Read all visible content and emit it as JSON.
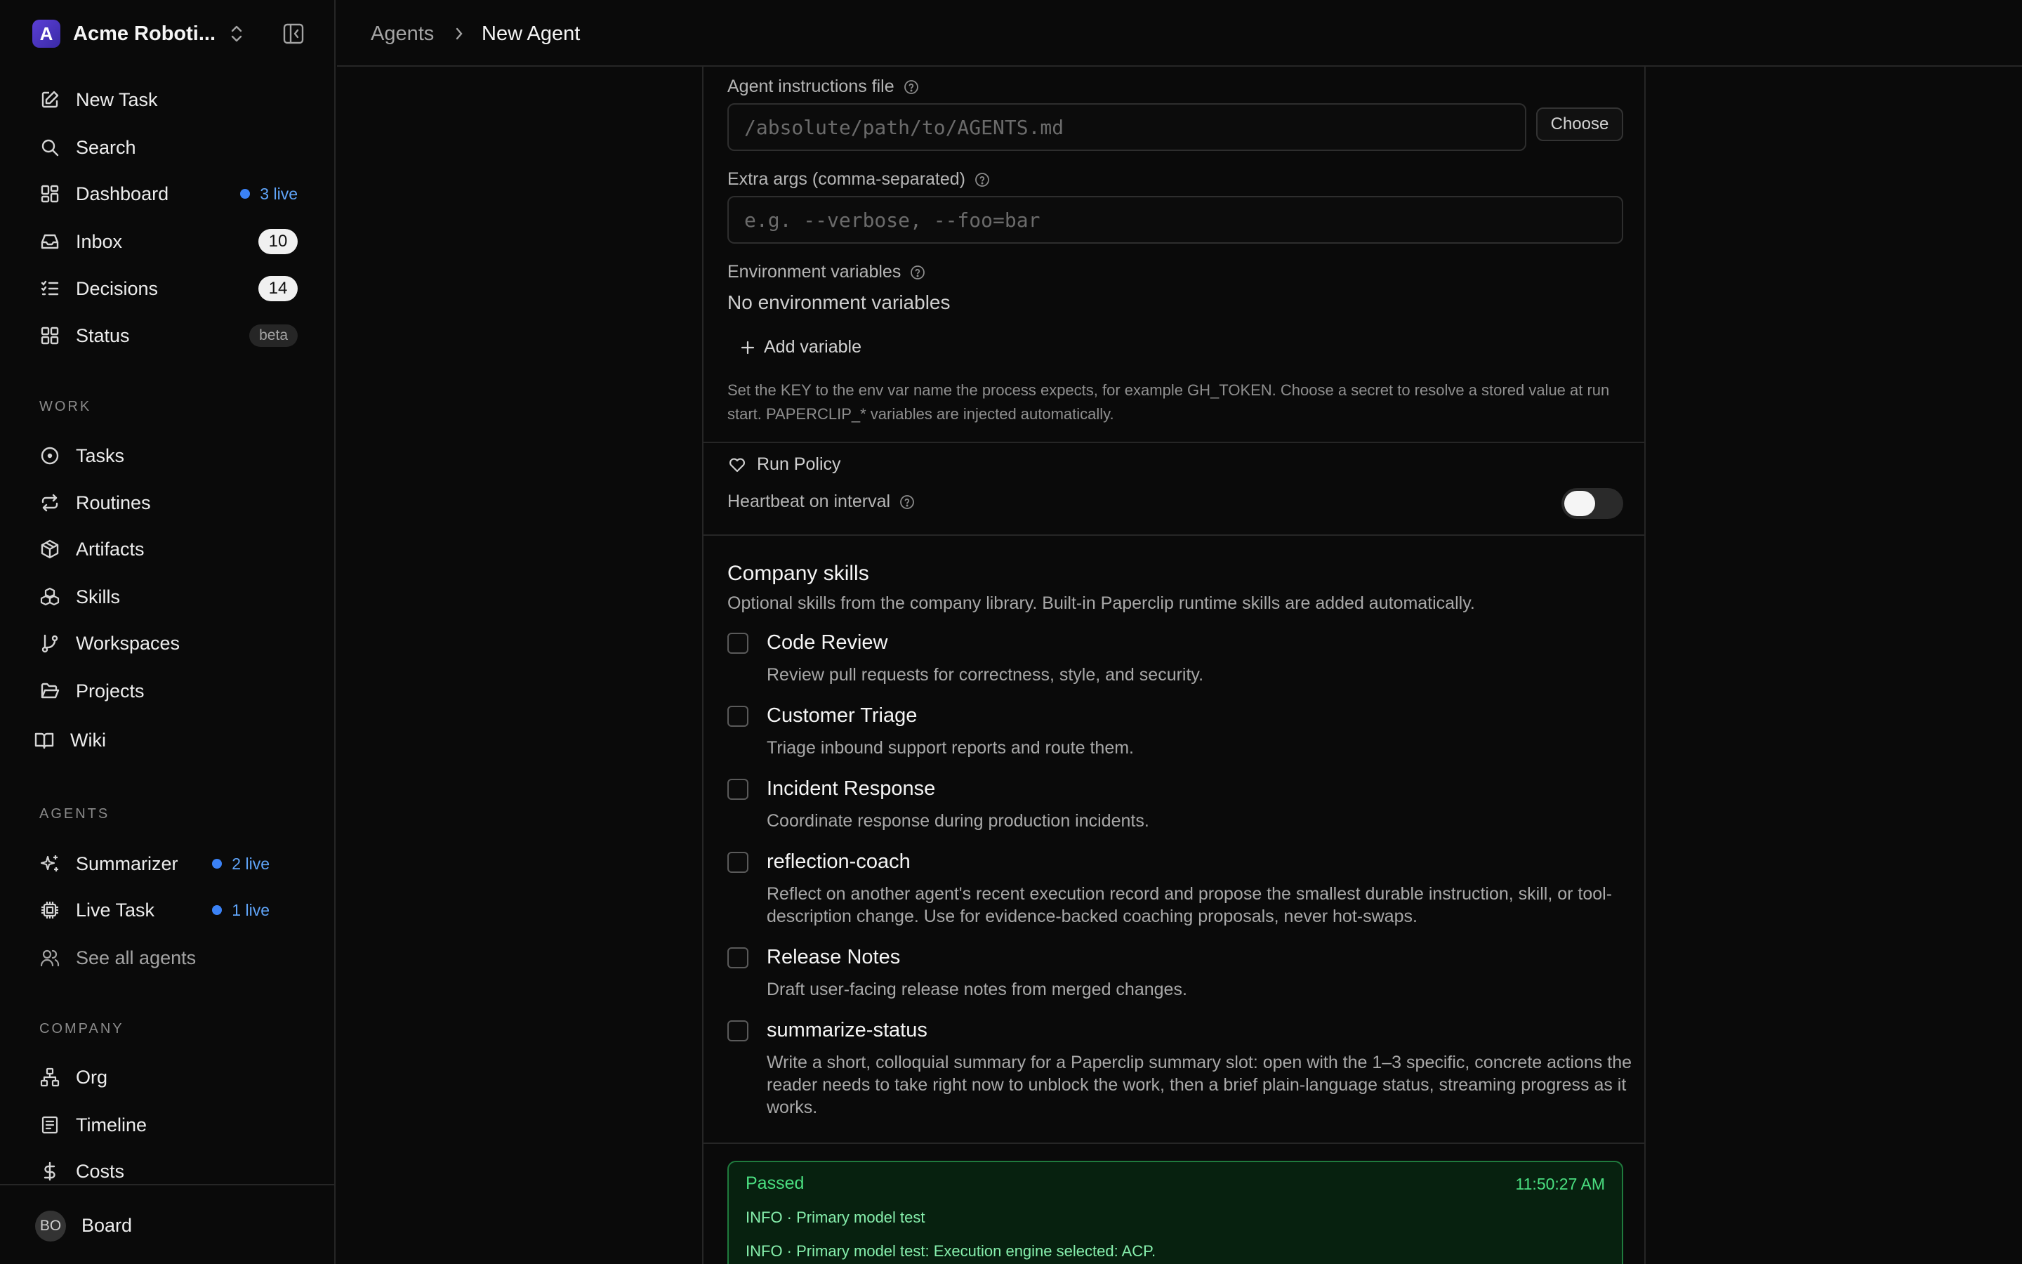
{
  "sidebar": {
    "company_initial": "A",
    "company_name": "Acme Roboti...",
    "nav": [
      {
        "label": "New Task"
      },
      {
        "label": "Search"
      },
      {
        "label": "Dashboard",
        "live": "3 live"
      },
      {
        "label": "Inbox",
        "count": "10"
      },
      {
        "label": "Decisions",
        "count": "14"
      },
      {
        "label": "Status",
        "tag": "beta"
      }
    ],
    "work_label": "WORK",
    "work": [
      {
        "label": "Tasks"
      },
      {
        "label": "Routines"
      },
      {
        "label": "Artifacts"
      },
      {
        "label": "Skills"
      },
      {
        "label": "Workspaces"
      },
      {
        "label": "Projects"
      },
      {
        "label": "Wiki"
      }
    ],
    "agents_label": "AGENTS",
    "agents": [
      {
        "label": "Summarizer",
        "live": "2 live"
      },
      {
        "label": "Live Task",
        "live": "1 live"
      },
      {
        "label": "See all agents"
      }
    ],
    "company_label": "COMPANY",
    "company": [
      {
        "label": "Org"
      },
      {
        "label": "Timeline"
      },
      {
        "label": "Costs"
      }
    ],
    "footer": {
      "avatar": "BO",
      "label": "Board"
    }
  },
  "breadcrumb": {
    "parent": "Agents",
    "current": "New Agent"
  },
  "form": {
    "instructions_label": "Agent instructions file",
    "instructions_placeholder": "/absolute/path/to/AGENTS.md",
    "choose_label": "Choose",
    "extra_args_label": "Extra args (comma-separated)",
    "extra_args_placeholder": "e.g. --verbose, --foo=bar",
    "env_label": "Environment variables",
    "env_empty": "No environment variables",
    "add_variable": "Add variable",
    "env_hint": "Set the KEY to the env var name the process expects, for example GH_TOKEN. Choose a secret to resolve a stored value at run start. PAPERCLIP_* variables are injected automatically.",
    "run_policy_label": "Run Policy",
    "heartbeat_label": "Heartbeat on interval",
    "heartbeat_enabled": false
  },
  "skills": {
    "title": "Company skills",
    "subtitle": "Optional skills from the company library. Built-in Paperclip runtime skills are added automatically.",
    "items": [
      {
        "name": "Code Review",
        "desc": "Review pull requests for correctness, style, and security."
      },
      {
        "name": "Customer Triage",
        "desc": "Triage inbound support reports and route them."
      },
      {
        "name": "Incident Response",
        "desc": "Coordinate response during production incidents."
      },
      {
        "name": "reflection-coach",
        "desc": "Reflect on another agent's recent execution record and propose the smallest durable instruction, skill, or tool-description change. Use for evidence-backed coaching proposals, never hot-swaps."
      },
      {
        "name": "Release Notes",
        "desc": "Draft user-facing release notes from merged changes."
      },
      {
        "name": "summarize-status",
        "desc": "Write a short, colloquial summary for a Paperclip summary slot: open with the 1–3 specific, concrete actions the reader needs to take right now to unblock the work, then a brief plain-language status, streaming progress as it works."
      }
    ]
  },
  "test_log": {
    "status": "Passed",
    "time": "11:50:27 AM",
    "lines": [
      {
        "level": "INFO",
        "text": "Primary model test"
      },
      {
        "level": "INFO",
        "text": "Primary model test: Execution engine selected: ACP."
      }
    ]
  }
}
